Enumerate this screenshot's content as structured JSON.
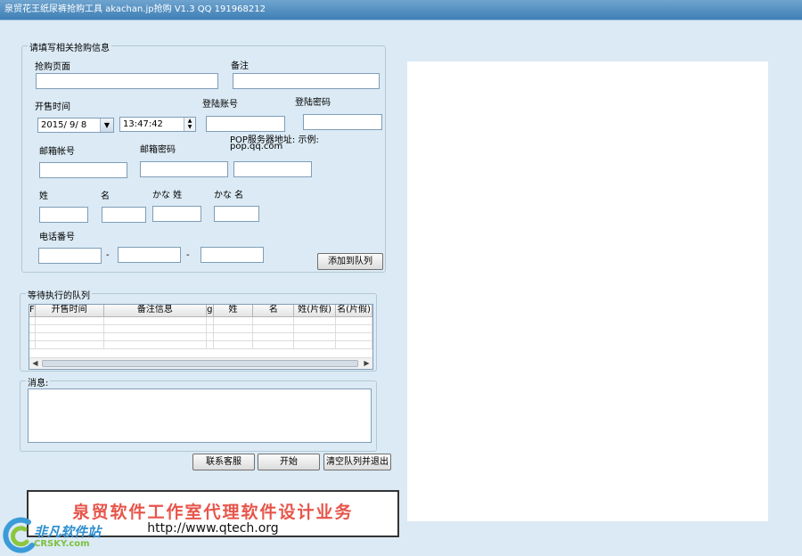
{
  "window": {
    "title": "泉贸花王纸尿裤抢购工具 akachan.jp抢购 V1.3 QQ 191968212"
  },
  "info_group": {
    "legend": "请填写相关抢购信息",
    "purchase_page_label": "抢购页面",
    "note_label": "备注",
    "sale_time_label": "开售时间",
    "sale_date": "2015/ 9/ 8",
    "sale_time": "13:47:42",
    "login_account_label": "登陆账号",
    "login_password_label": "登陆密码",
    "email_account_label": "邮箱帐号",
    "email_password_label": "邮箱密码",
    "pop_server_label": "POP服务器地址: 示例:",
    "pop_server_example": "pop.qq.com",
    "last_name_label": "姓",
    "first_name_label": "名",
    "kana_last_name_label": "かな 姓",
    "kana_first_name_label": "かな 名",
    "phone_label": "电话番号",
    "phone_sep": "-",
    "add_button": "添加到队列"
  },
  "queue_group": {
    "legend": "等待执行的队列",
    "columns": [
      "F",
      "开售时间",
      "备注信息",
      "g",
      "姓",
      "名",
      "姓(片假)",
      "名(片假)"
    ]
  },
  "message_group": {
    "legend": "消息:"
  },
  "buttons": {
    "contact": "联系客服",
    "start": "开始",
    "clear_exit": "清空队列并退出"
  },
  "banner": {
    "main_text": "泉贸软件工作室代理软件设计业务",
    "url": "http://www.qtech.org"
  },
  "watermark": {
    "brand": "非凡软件站",
    "domain": "CRSKY.com"
  }
}
